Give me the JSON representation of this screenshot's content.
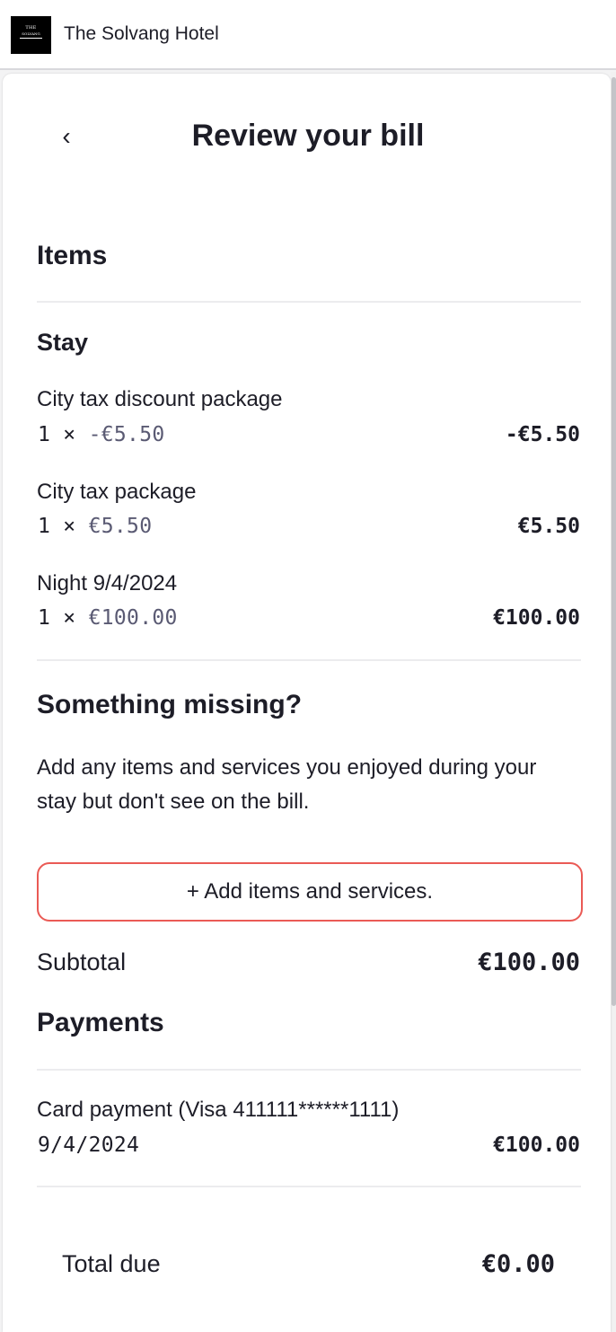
{
  "header": {
    "logo_line1": "THE",
    "logo_line2": "SOLVANG",
    "hotel_name": "The Solvang Hotel"
  },
  "page": {
    "back_glyph": "‹",
    "title": "Review your bill"
  },
  "items_section": {
    "heading": "Items",
    "group_heading": "Stay",
    "items": [
      {
        "name": "City tax discount package",
        "qty": "1 ×",
        "unit_price": "-€5.50",
        "amount": "-€5.50"
      },
      {
        "name": "City tax package",
        "qty": "1 ×",
        "unit_price": "€5.50",
        "amount": "€5.50"
      },
      {
        "name": "Night 9/4/2024",
        "qty": "1 ×",
        "unit_price": "€100.00",
        "amount": "€100.00"
      }
    ]
  },
  "missing_section": {
    "heading": "Something missing?",
    "description": "Add any items and services you enjoyed during your stay but don't see on the bill.",
    "add_button_label": "+ Add items and services."
  },
  "subtotal": {
    "label": "Subtotal",
    "amount": "€100.00"
  },
  "payments_section": {
    "heading": "Payments",
    "payments": [
      {
        "label": "Card payment (Visa 411111******1111)",
        "date": "9/4/2024",
        "amount": "€100.00"
      }
    ]
  },
  "total_due": {
    "label": "Total due",
    "amount": "€0.00"
  },
  "colors": {
    "accent_border": "#ea5a55",
    "text": "#1d1d27",
    "muted_price": "#5a5a73"
  }
}
